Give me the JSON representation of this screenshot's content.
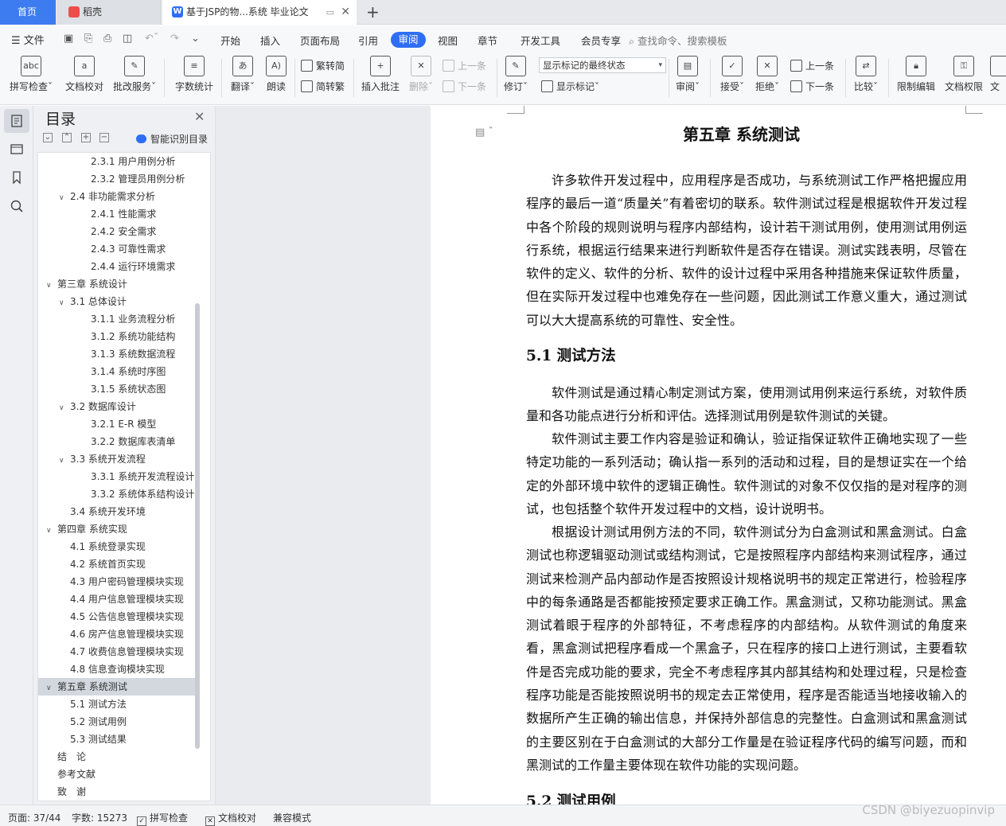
{
  "tabs": {
    "home": "首页",
    "daoke": "稻壳",
    "doc": "基于JSP的物...系统 毕业论文"
  },
  "menu": {
    "file": "文件",
    "items": [
      "开始",
      "插入",
      "页面布局",
      "引用",
      "审阅",
      "视图",
      "章节",
      "开发工具",
      "会员专享"
    ],
    "active": "审阅",
    "search": "查找命令、搜索模板"
  },
  "ribbon": {
    "spell": "拼写检查",
    "proof": "文档校对",
    "annotate": "批改服务",
    "wordcount": "字数统计",
    "translate": "翻译",
    "read": "朗读",
    "trad": "繁转简",
    "simp": "简转繁",
    "insert_comment": "插入批注",
    "delete": "删除",
    "prev_comment": "上一条",
    "next_comment": "下一条",
    "track": "修订",
    "markup_select": "显示标记的最终状态",
    "show_markup": "显示标记",
    "review": "审阅",
    "accept": "接受",
    "reject": "拒绝",
    "prev": "上一条",
    "next": "下一条",
    "compare": "比较",
    "restrict": "限制编辑",
    "perm": "文档权限"
  },
  "toc": {
    "title": "目录",
    "smart": "智能识别目录",
    "items": [
      {
        "label": "2.3.1 用户用例分析",
        "level": 3,
        "chev": ""
      },
      {
        "label": "2.3.2 管理员用例分析",
        "level": 3,
        "chev": ""
      },
      {
        "label": "2.4 非功能需求分析",
        "level": 2,
        "chev": "∨"
      },
      {
        "label": "2.4.1 性能需求",
        "level": 3,
        "chev": ""
      },
      {
        "label": "2.4.2 安全需求",
        "level": 3,
        "chev": ""
      },
      {
        "label": "2.4.3 可靠性需求",
        "level": 3,
        "chev": ""
      },
      {
        "label": "2.4.4 运行环境需求",
        "level": 3,
        "chev": ""
      },
      {
        "label": "第三章 系统设计",
        "level": 1,
        "chev": "∨"
      },
      {
        "label": "3.1 总体设计",
        "level": 2,
        "chev": "∨"
      },
      {
        "label": "3.1.1 业务流程分析",
        "level": 3,
        "chev": ""
      },
      {
        "label": "3.1.2 系统功能结构",
        "level": 3,
        "chev": ""
      },
      {
        "label": "3.1.3 系统数据流程",
        "level": 3,
        "chev": ""
      },
      {
        "label": "3.1.4 系统时序图",
        "level": 3,
        "chev": ""
      },
      {
        "label": "3.1.5 系统状态图",
        "level": 3,
        "chev": ""
      },
      {
        "label": "3.2 数据库设计",
        "level": 2,
        "chev": "∨"
      },
      {
        "label": "3.2.1 E-R 模型",
        "level": 3,
        "chev": ""
      },
      {
        "label": "3.2.2 数据库表清单",
        "level": 3,
        "chev": ""
      },
      {
        "label": "3.3 系统开发流程",
        "level": 2,
        "chev": "∨"
      },
      {
        "label": "3.3.1 系统开发流程设计",
        "level": 3,
        "chev": ""
      },
      {
        "label": "3.3.2 系统体系结构设计",
        "level": 3,
        "chev": ""
      },
      {
        "label": "3.4 系统开发环境",
        "level": 2,
        "chev": ""
      },
      {
        "label": "第四章 系统实现",
        "level": 1,
        "chev": "∨"
      },
      {
        "label": "4.1 系统登录实现",
        "level": 2,
        "chev": ""
      },
      {
        "label": "4.2 系统首页实现",
        "level": 2,
        "chev": ""
      },
      {
        "label": "4.3 用户密码管理模块实现",
        "level": 2,
        "chev": ""
      },
      {
        "label": "4.4 用户信息管理模块实现",
        "level": 2,
        "chev": ""
      },
      {
        "label": "4.5 公告信息管理模块实现",
        "level": 2,
        "chev": ""
      },
      {
        "label": "4.6 房产信息管理模块实现",
        "level": 2,
        "chev": ""
      },
      {
        "label": "4.7 收费信息管理模块实现",
        "level": 2,
        "chev": ""
      },
      {
        "label": "4.8 信息查询模块实现",
        "level": 2,
        "chev": ""
      },
      {
        "label": "第五章 系统测试",
        "level": 1,
        "chev": "∨",
        "selected": true
      },
      {
        "label": "5.1 测试方法",
        "level": 2,
        "chev": ""
      },
      {
        "label": "5.2 测试用例",
        "level": 2,
        "chev": ""
      },
      {
        "label": "5.3 测试结果",
        "level": 2,
        "chev": ""
      },
      {
        "label": "结　论",
        "level": 1,
        "chev": ""
      },
      {
        "label": "参考文献",
        "level": 1,
        "chev": ""
      },
      {
        "label": "致　谢",
        "level": 1,
        "chev": ""
      }
    ]
  },
  "doc": {
    "chapter_title": "第五章  系统测试",
    "p1": "许多软件开发过程中，应用程序是否成功，与系统测试工作严格把握应用程序的最后一道“质量关”有着密切的联系。软件测试过程是根据软件开发过程中各个阶段的规则说明与程序内部结构，设计若干测试用例，使用测试用例运行系统，根据运行结果来进行判断软件是否存在错误。测试实践表明，尽管在软件的定义、软件的分析、软件的设计过程中采用各种措施来保证软件质量，但在实际开发过程中也难免存在一些问题，因此测试工作意义重大，通过测试可以大大提高系统的可靠性、安全性。",
    "h_51": "5.1  测试方法",
    "p2": "软件测试是通过精心制定测试方案，使用测试用例来运行系统，对软件质量和各功能点进行分析和评估。选择测试用例是软件测试的关键。",
    "p3": "软件测试主要工作内容是验证和确认，验证指保证软件正确地实现了一些特定功能的一系列活动；确认指一系列的活动和过程，目的是想证实在一个给定的外部环境中软件的逻辑正确性。软件测试的对象不仅仅指的是对程序的测试，也包括整个软件开发过程中的文档，设计说明书。",
    "p4": "根据设计测试用例方法的不同，软件测试分为白盒测试和黑盒测试。白盒测试也称逻辑驱动测试或结构测试，它是按照程序内部结构来测试程序，通过测试来检测产品内部动作是否按照设计规格说明书的规定正常进行，检验程序中的每条通路是否都能按预定要求正确工作。黑盒测试，又称功能测试。黑盒测试着眼于程序的外部特征，不考虑程序的内部结构。从软件测试的角度来看，黑盒测试把程序看成一个黑盒子，只在程序的接口上进行测试，主要看软件是否完成功能的要求，完全不考虑程序其内部其结构和处理过程，只是检查程序功能是否能按照说明书的规定去正常使用，程序是否能适当地接收输入的数据所产生正确的输出信息，并保持外部信息的完整性。白盒测试和黑盒测试的主要区别在于白盒测试的大部分工作量是在验证程序代码的编写问题，而和黑测试的工作量主要体现在软件功能的实现问题。",
    "h_52": "5.2  测试用例"
  },
  "status": {
    "page": "页面: 37/44",
    "words": "字数: 15273",
    "spell": "拼写检查",
    "proof": "文档校对",
    "compat": "兼容模式"
  },
  "watermark": "CSDN @biyezuopinvip"
}
